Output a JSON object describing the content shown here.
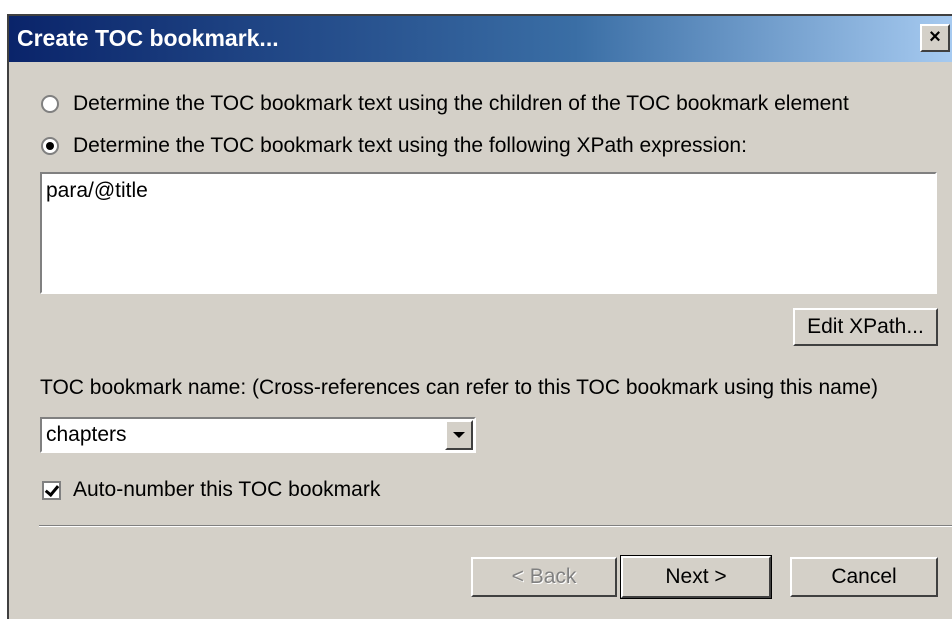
{
  "dialog": {
    "title": "Create TOC bookmark...",
    "close_label": "×"
  },
  "options": {
    "radio_children": "Determine the TOC bookmark text using the children of the TOC bookmark element",
    "radio_xpath": "Determine the TOC bookmark text using the following XPath expression:",
    "selected": "xpath"
  },
  "xpath": {
    "value": "para/@title",
    "edit_button": "Edit XPath..."
  },
  "bookmark": {
    "name_label": "TOC bookmark name: (Cross-references can refer to this TOC bookmark using this name)",
    "name_value": "chapters",
    "auto_number_label": "Auto-number this TOC bookmark",
    "auto_number_checked": true
  },
  "footer": {
    "back": "< Back",
    "next": "Next >",
    "cancel": "Cancel"
  }
}
